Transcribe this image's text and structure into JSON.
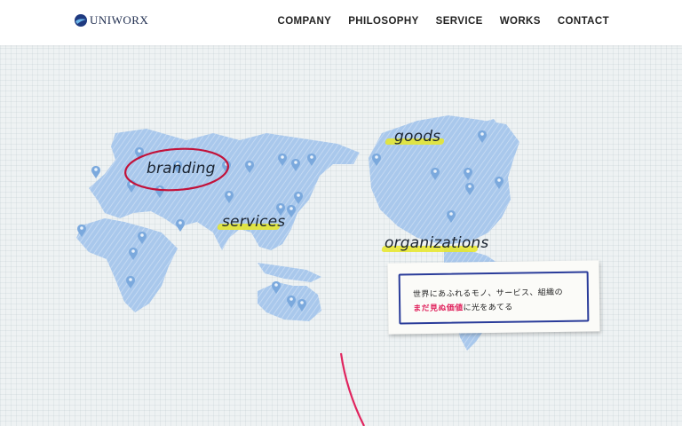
{
  "header": {
    "logo_text": "UNIWORX",
    "nav": [
      {
        "label": "COMPANY"
      },
      {
        "label": "PHILOSOPHY"
      },
      {
        "label": "SERVICE"
      },
      {
        "label": "WORKS"
      },
      {
        "label": "CONTACT"
      }
    ]
  },
  "hero": {
    "tags": {
      "branding": "branding",
      "services": "services",
      "goods": "goods",
      "organizations": "organizations"
    },
    "card": {
      "line1": "世界にあふれるモノ、サービス、組織の",
      "line2_highlight": "まだ見ぬ価値",
      "line2_rest": "に光をあてる"
    }
  },
  "colors": {
    "accent_red": "#c2123a",
    "map_blue": "#a9c8ec",
    "highlight": "#e8e828",
    "frame_blue": "#2a3c9a"
  },
  "icons": [
    "logo-wave-icon",
    "map-pin-icon"
  ]
}
